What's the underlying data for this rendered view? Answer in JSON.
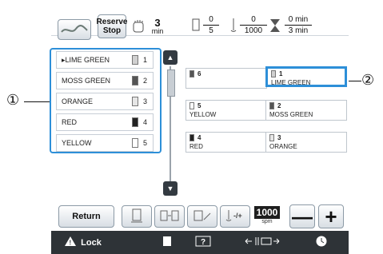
{
  "header": {
    "reserve_line1": "Reserve",
    "reserve_line2": "Stop",
    "timer_value": "3",
    "timer_unit": "min",
    "color_count_top": "0",
    "color_count_bottom": "5",
    "stitch_count_top": "0",
    "stitch_count_bottom": "1000",
    "time_top": "0 min",
    "time_bottom": "3 min"
  },
  "thread_list": {
    "items": [
      {
        "label": "LIME GREEN",
        "num": "1",
        "marker": "▸"
      },
      {
        "label": "MOSS GREEN",
        "num": "2",
        "marker": ""
      },
      {
        "label": "ORANGE",
        "num": "3",
        "marker": ""
      },
      {
        "label": "RED",
        "num": "4",
        "marker": ""
      },
      {
        "label": "YELLOW",
        "num": "5",
        "marker": ""
      }
    ]
  },
  "needle_grid": {
    "cells": [
      {
        "num": "6",
        "label": ""
      },
      {
        "num": "1",
        "label": "LIME GREEN"
      },
      {
        "num": "5",
        "label": "YELLOW"
      },
      {
        "num": "2",
        "label": "MOSS GREEN"
      },
      {
        "num": "4",
        "label": "RED"
      },
      {
        "num": "3",
        "label": "ORANGE"
      }
    ]
  },
  "callouts": {
    "one": "①",
    "two": "②"
  },
  "bottom": {
    "return_label": "Return",
    "speed_value": "1000",
    "speed_unit": "spm",
    "minus": "—",
    "plus": "+"
  },
  "nav": {
    "lock_label": "Lock"
  },
  "colors": {
    "accent": "#2d8fd8",
    "nav_bg": "#2e3337"
  }
}
